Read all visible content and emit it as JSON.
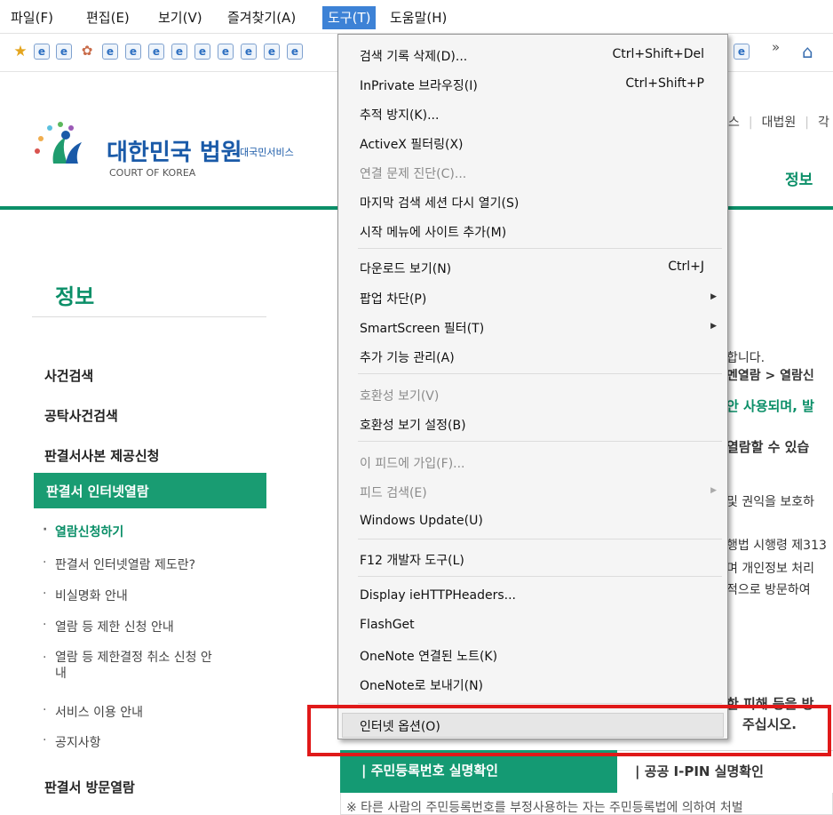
{
  "menubar": {
    "items": [
      "파일(F)",
      "편집(E)",
      "보기(V)",
      "즐겨찾기(A)",
      "도구(T)",
      "도움말(H)"
    ],
    "active": "도구(T)"
  },
  "favbar": {
    "overflow": "»"
  },
  "header": {
    "title": "대한민국 법원",
    "subtitle": "대국민서비스",
    "eng": "COURT OF KOREA",
    "topnav": [
      "스",
      "대법원",
      "각"
    ],
    "gnb": "정보"
  },
  "sidebar": {
    "title": "정보",
    "items": [
      "사건검색",
      "공탁사건검색",
      "판결서사본 제공신청"
    ],
    "active": "판결서 인터넷열람",
    "subitems": [
      "열람신청하기",
      "판결서 인터넷열람 제도란?",
      "비실명화 안내",
      "열람 등 제한 신청 안내",
      "열람 등 제한결정 취소 신청 안\n내",
      "서비스 이용 안내",
      "공지사항"
    ],
    "bottom": "판결서 방문열람"
  },
  "content": {
    "lines": [
      "합니다.",
      "멘열람 > 열람신",
      "안 사용되며, 발",
      "열람할 수 있습",
      "및 권익을 보호하",
      "행법 시행령 제313",
      "며 개인정보 처리",
      "적으로 방문하여",
      "한 피해 등을 방",
      "주십시오."
    ],
    "tab1": "| 주민등록번호 실명확인",
    "tab2": "| 공공 I-PIN 실명확인",
    "notice": "※ 타른 사람의 주민등록번호를 부정사용하는 자는 주민등록법에 의하여 처벌"
  },
  "menu": {
    "items": [
      {
        "label": "검색 기록 삭제(D)...",
        "shortcut": "Ctrl+Shift+Del"
      },
      {
        "label": "InPrivate 브라우징(I)",
        "shortcut": "Ctrl+Shift+P"
      },
      {
        "label": "추적 방지(K)..."
      },
      {
        "label": "ActiveX 필터링(X)"
      },
      {
        "label": "연결 문제 진단(C)...",
        "disabled": true
      },
      {
        "label": "마지막 검색 세션 다시 열기(S)"
      },
      {
        "label": "시작 메뉴에 사이트 추가(M)"
      },
      {
        "label": "다운로드 보기(N)",
        "shortcut": "Ctrl+J"
      },
      {
        "label": "팝업 차단(P)",
        "submenu": "▶"
      },
      {
        "label": "SmartScreen 필터(T)",
        "submenu": "▶"
      },
      {
        "label": "추가 기능 관리(A)"
      },
      {
        "label": "호환성 보기(V)",
        "disabled": true
      },
      {
        "label": "호환성 보기 설정(B)"
      },
      {
        "label": "이 피드에 가입(F)...",
        "disabled": true
      },
      {
        "label": "피드 검색(E)",
        "disabled": true,
        "submenu": "▶"
      },
      {
        "label": "Windows Update(U)"
      },
      {
        "label": "F12 개발자 도구(L)"
      },
      {
        "label": "Display ieHTTPHeaders..."
      },
      {
        "label": "FlashGet"
      },
      {
        "label": "OneNote 연결된 노트(K)"
      },
      {
        "label": "OneNote로 보내기(N)"
      },
      {
        "label": "인터넷 옵션(O)",
        "highlighted": true
      }
    ]
  },
  "colors": {
    "accent": "#0b8f68",
    "menu_highlight": "#3d82d6",
    "annotation": "#e01919"
  }
}
